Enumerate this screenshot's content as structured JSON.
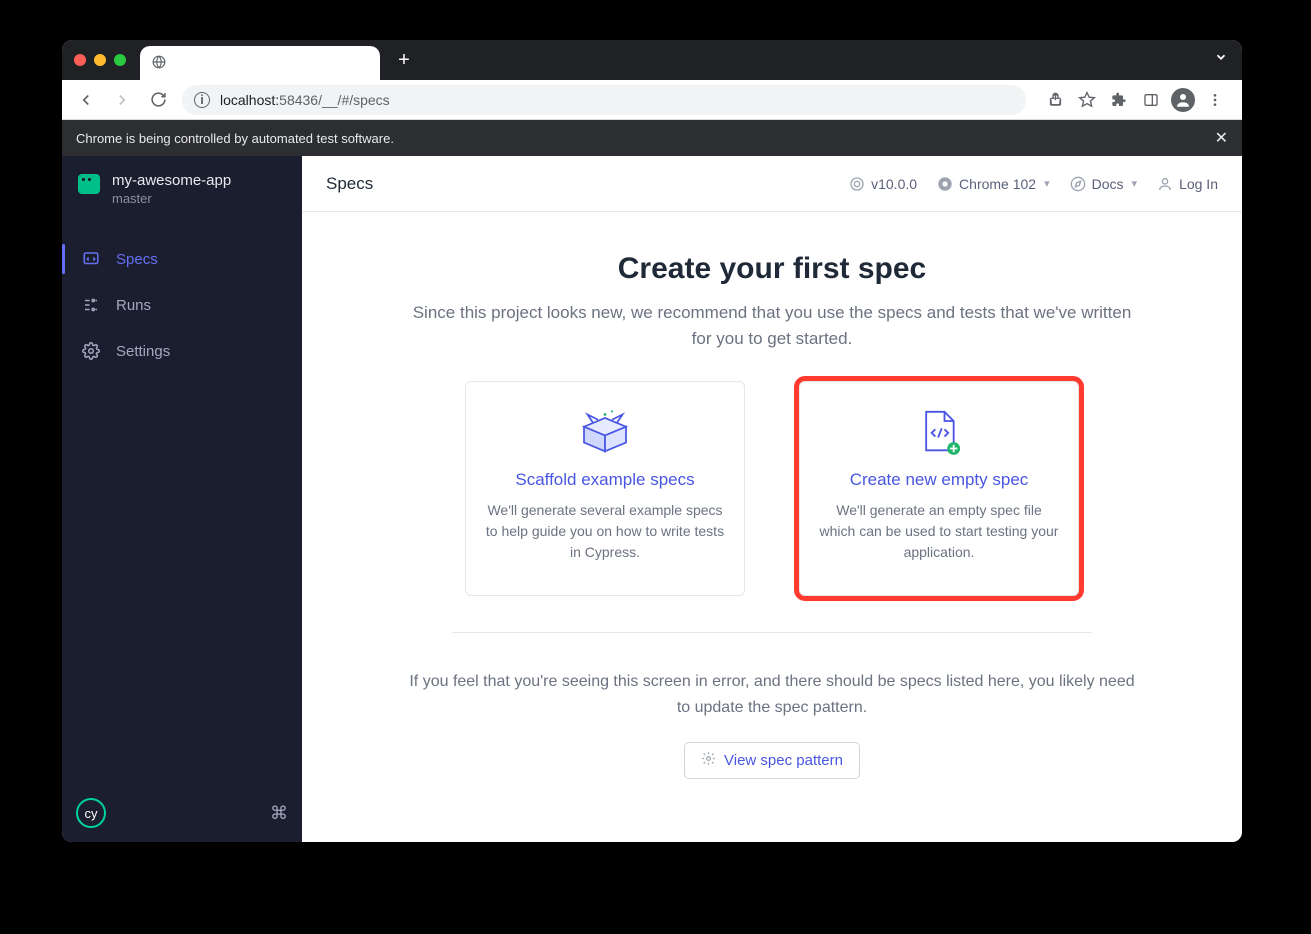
{
  "browser": {
    "url_host": "localhost:",
    "url_port_path": "58436/__/#/specs"
  },
  "automation_bar": {
    "message": "Chrome is being controlled by automated test software."
  },
  "sidebar": {
    "project_name": "my-awesome-app",
    "branch": "master",
    "nav": [
      {
        "label": "Specs"
      },
      {
        "label": "Runs"
      },
      {
        "label": "Settings"
      }
    ],
    "logo_text": "cy"
  },
  "topbar": {
    "title": "Specs",
    "version": "v10.0.0",
    "browser": "Chrome 102",
    "docs": "Docs",
    "login": "Log In"
  },
  "content": {
    "heading": "Create your first spec",
    "subhead": "Since this project looks new, we recommend that you use the specs and tests that we've written for you to get started.",
    "cards": [
      {
        "title": "Scaffold example specs",
        "desc": "We'll generate several example specs to help guide you on how to write tests in Cypress."
      },
      {
        "title": "Create new empty spec",
        "desc": "We'll generate an empty spec file which can be used to start testing your application."
      }
    ],
    "footer_text": "If you feel that you're seeing this screen in error, and there should be specs listed here, you likely need to update the spec pattern.",
    "view_button": "View spec pattern"
  }
}
